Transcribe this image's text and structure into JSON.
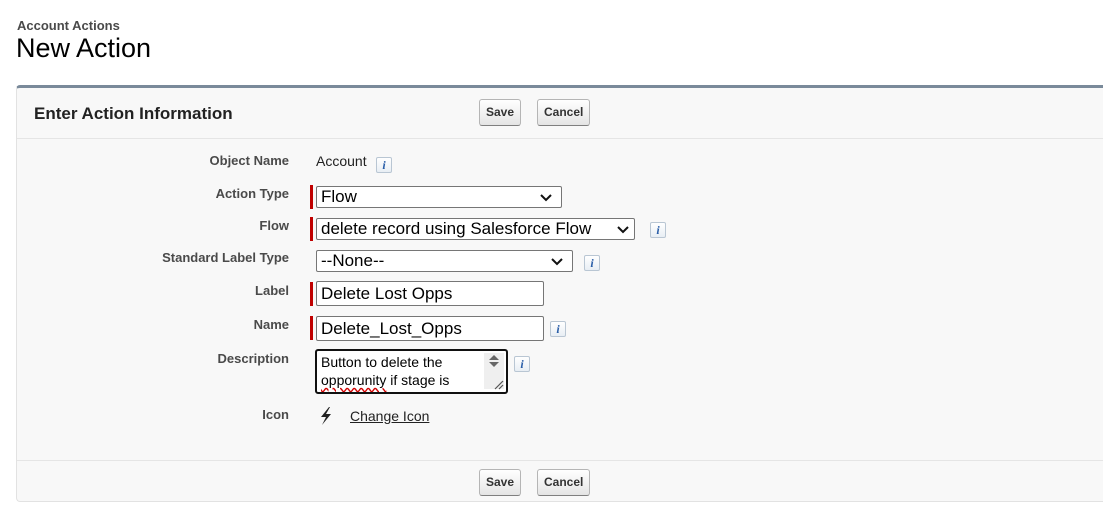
{
  "header": {
    "breadcrumb": "Account Actions",
    "title": "New Action"
  },
  "panel": {
    "title": "Enter Action Information",
    "save_label": "Save",
    "cancel_label": "Cancel"
  },
  "form": {
    "object_name": {
      "label": "Object Name",
      "value": "Account"
    },
    "action_type": {
      "label": "Action Type",
      "value": "Flow",
      "required": true
    },
    "flow": {
      "label": "Flow",
      "value": "delete record using Salesforce Flow",
      "required": true
    },
    "standard_label_type": {
      "label": "Standard Label Type",
      "value": "--None--"
    },
    "label": {
      "label": "Label",
      "value": "Delete Lost Opps",
      "required": true
    },
    "name": {
      "label": "Name",
      "value": "Delete_Lost_Opps",
      "required": true
    },
    "description": {
      "label": "Description",
      "line1": "Button to delete the",
      "line2_word": "opporunity",
      "line2_rest": " if stage is"
    },
    "icon": {
      "label": "Icon",
      "icon_name": "lightning-bolt-icon",
      "change_label": "Change Icon"
    }
  },
  "colors": {
    "required_marker": "#c00000",
    "panel_border": "#7a8a9a",
    "info_icon_text": "#2a5ea8"
  }
}
